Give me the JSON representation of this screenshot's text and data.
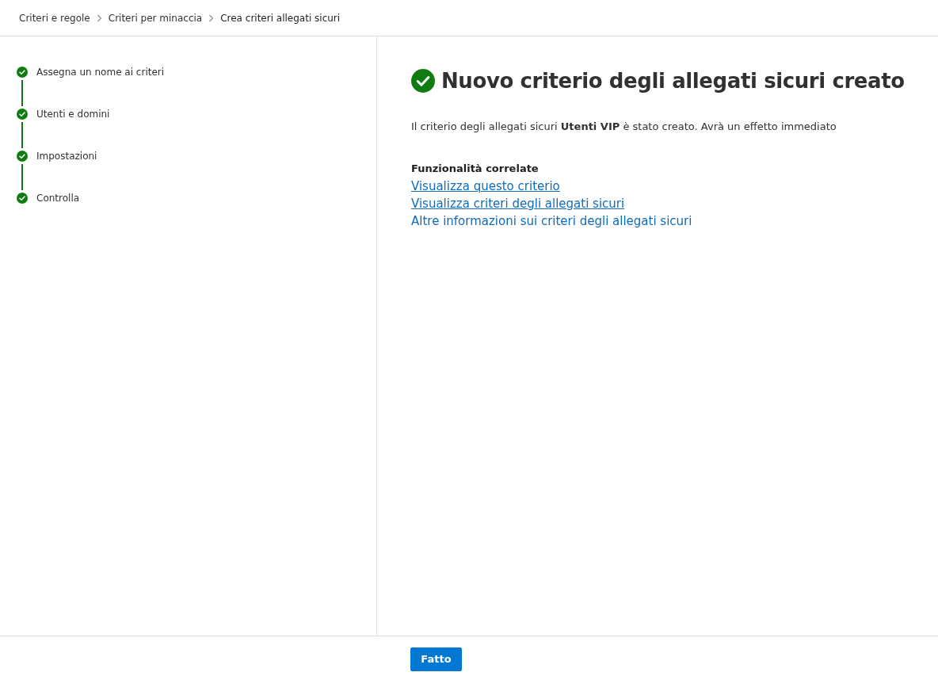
{
  "breadcrumb": [
    {
      "label": "Criteri e regole",
      "current": false
    },
    {
      "label": "Criteri per minaccia",
      "current": false
    },
    {
      "label": "Crea criteri allegati sicuri",
      "current": true
    }
  ],
  "steps": [
    {
      "label": "Assegna un nome ai criteri",
      "completed": true
    },
    {
      "label": "Utenti e domini",
      "completed": true
    },
    {
      "label": "Impostazioni",
      "completed": true
    },
    {
      "label": "Controlla",
      "completed": true
    }
  ],
  "result": {
    "title": "Nuovo criterio degli allegati sicuri creato",
    "succeeded": true,
    "message": "Il criterio degli allegati sicuri **Utenti VIP** è stato creato. Avrà un effetto immediato",
    "related_heading": "Funzionalità correlate",
    "links": [
      {
        "label": "Visualizza questo criterio",
        "underlined": true
      },
      {
        "label": "Visualizza criteri degli allegati sicuri",
        "underlined": true
      },
      {
        "label": "Altre informazioni sui criteri degli allegati sicuri",
        "underlined": false
      }
    ]
  },
  "footer": {
    "buttons": [
      {
        "label": "Fatto",
        "kind": "primary"
      }
    ]
  }
}
